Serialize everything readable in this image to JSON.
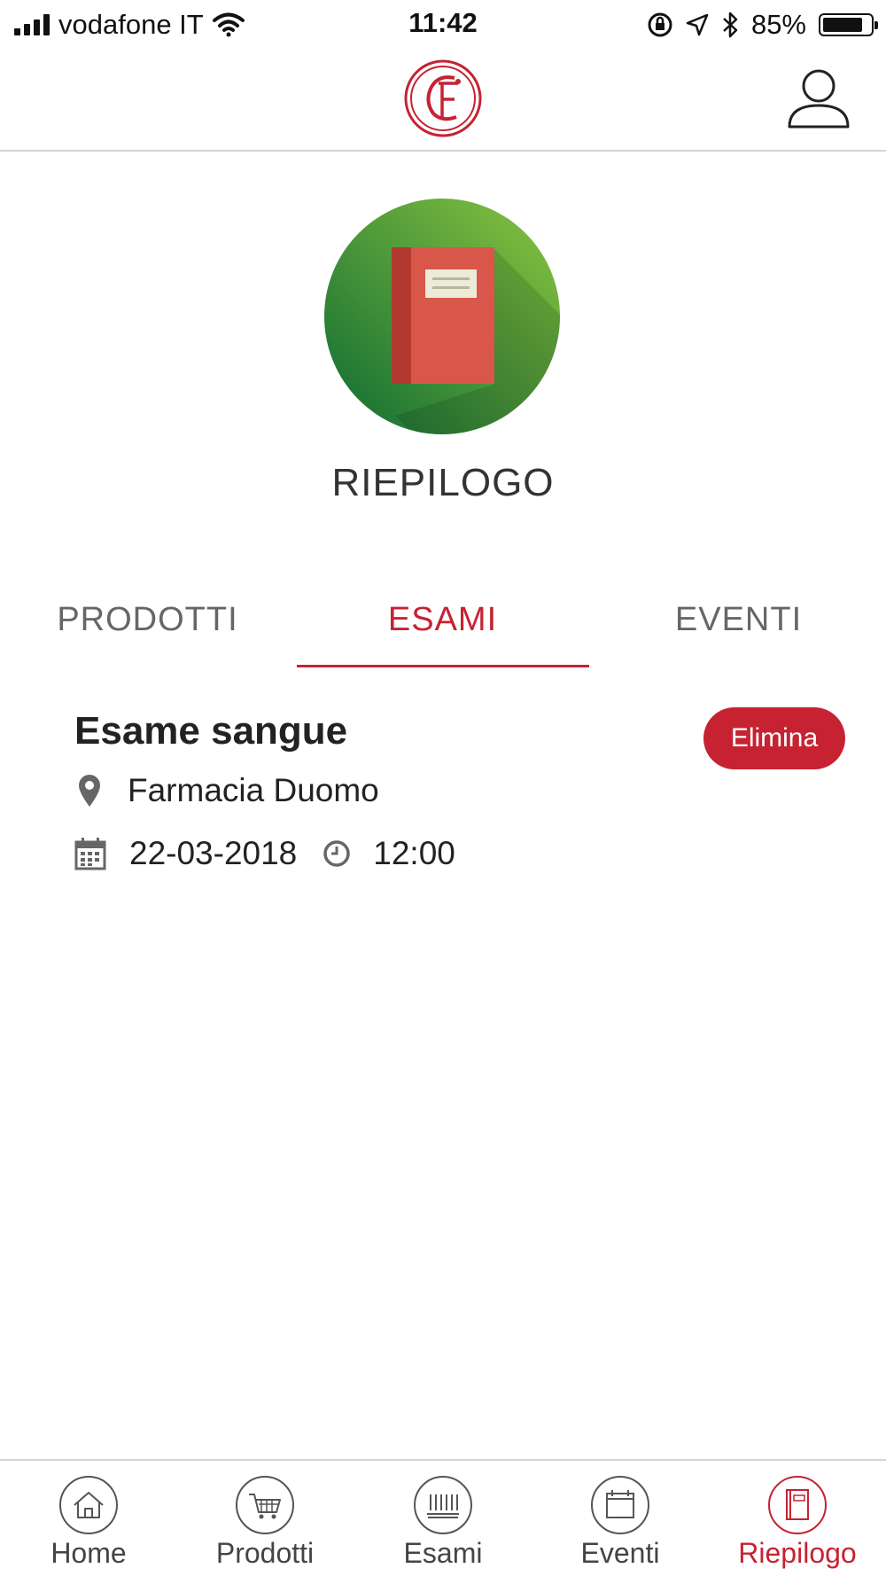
{
  "status_bar": {
    "carrier": "vodafone IT",
    "time": "11:42",
    "battery_percent": "85%",
    "battery_level": 0.85
  },
  "header": {
    "logo_icon": "pharmacy-monogram-logo",
    "account_icon": "user-icon"
  },
  "hero": {
    "icon": "book-icon",
    "title": "RIEPILOGO"
  },
  "tabs": [
    {
      "label": "PRODOTTI",
      "active": false
    },
    {
      "label": "ESAMI",
      "active": true
    },
    {
      "label": "EVENTI",
      "active": false
    }
  ],
  "booking": {
    "title": "Esame sangue",
    "delete_label": "Elimina",
    "location": "Farmacia Duomo",
    "date": "22-03-2018",
    "time": "12:00"
  },
  "bottom_nav": [
    {
      "label": "Home",
      "icon": "home-icon",
      "active": false
    },
    {
      "label": "Prodotti",
      "icon": "cart-icon",
      "active": false
    },
    {
      "label": "Esami",
      "icon": "test-tubes-icon",
      "active": false
    },
    {
      "label": "Eventi",
      "icon": "calendar-icon",
      "active": false
    },
    {
      "label": "Riepilogo",
      "icon": "book-icon",
      "active": true
    }
  ],
  "colors": {
    "accent": "#c62232",
    "hero_green_dark": "#1e7a3a",
    "hero_green_light": "#7cc044",
    "book_red": "#d9564a"
  }
}
